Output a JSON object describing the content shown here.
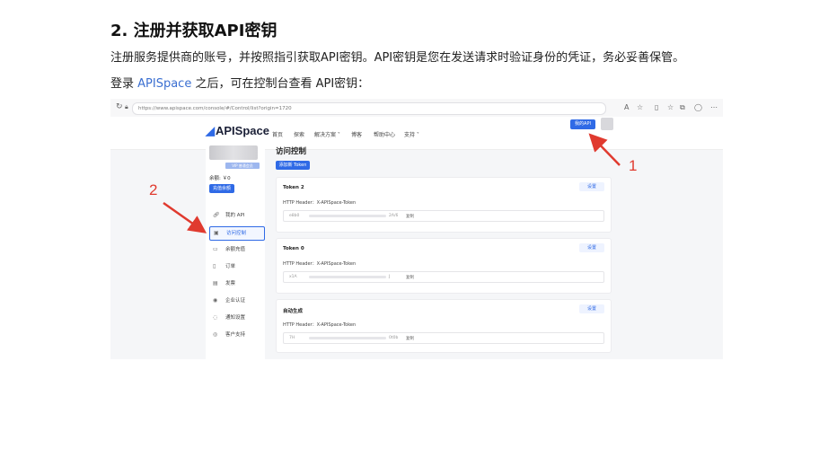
{
  "heading": "2. 注册并获取API密钥",
  "para1": "注册服务提供商的账号，并按照指引获取API密钥。API密钥是您在发送请求时验证身份的凭证，务必妥善保管。",
  "para2": {
    "before": "登录 ",
    "link": "APISpace",
    "after": " 之后，可在控制台查看 API密钥："
  },
  "browser": {
    "url": "https://www.apispace.com/console/#/Control/list?origin=1720",
    "nav_icons": [
      "back-icon",
      "refresh-icon",
      "lock-icon"
    ],
    "tool_icons": [
      "translate-icon",
      "star-icon",
      "split-view-icon",
      "favorites-icon",
      "collections-icon",
      "profile-icon",
      "more-icon"
    ]
  },
  "app": {
    "logo": "APISpace",
    "nav": [
      "首页",
      "探索",
      "解决方案 ˅",
      "博客",
      "帮助中心",
      "支持 ˅"
    ],
    "my_api_button": "我的API"
  },
  "sidebar": {
    "vip_badge": "VIP 普通会员",
    "balance": "余额: ￥0",
    "recharge_button": "充值余额",
    "items": [
      {
        "label": "我的 API",
        "icon": "link-icon"
      },
      {
        "label": "访问控制",
        "icon": "monitor-icon",
        "active": true
      },
      {
        "label": "余额充值",
        "icon": "wallet-icon"
      },
      {
        "label": "订单",
        "icon": "receipt-icon"
      },
      {
        "label": "发票",
        "icon": "invoice-icon"
      },
      {
        "label": "企业认证",
        "icon": "location-icon"
      },
      {
        "label": "通知设置",
        "icon": "bell-icon"
      },
      {
        "label": "客户支持",
        "icon": "support-icon"
      }
    ]
  },
  "main": {
    "title": "访问控制",
    "add_token_button": "添加新 Token",
    "cards": [
      {
        "title": "Token 2",
        "setting": "设置",
        "header": "HTTP Header：X-APISpace-Token",
        "key_prefix": "e8b0",
        "key_suffix": "2A/6",
        "copy": "复制"
      },
      {
        "title": "Token 0",
        "setting": "设置",
        "header": "HTTP Header：X-APISpace-Token",
        "key_prefix": "x1A",
        "key_suffix": "J",
        "copy": "复制"
      },
      {
        "title": "自动生成",
        "setting": "设置",
        "header": "HTTP Header：X-APISpace-Token",
        "key_prefix": "7H",
        "key_suffix": "0t0b",
        "copy": "复制"
      }
    ]
  },
  "annotations": {
    "arrow1_label": "1",
    "arrow2_label": "2",
    "arrow_color": "#e03a2f"
  },
  "colors": {
    "accent": "#2f6ae6",
    "link": "#3b6fd1"
  }
}
